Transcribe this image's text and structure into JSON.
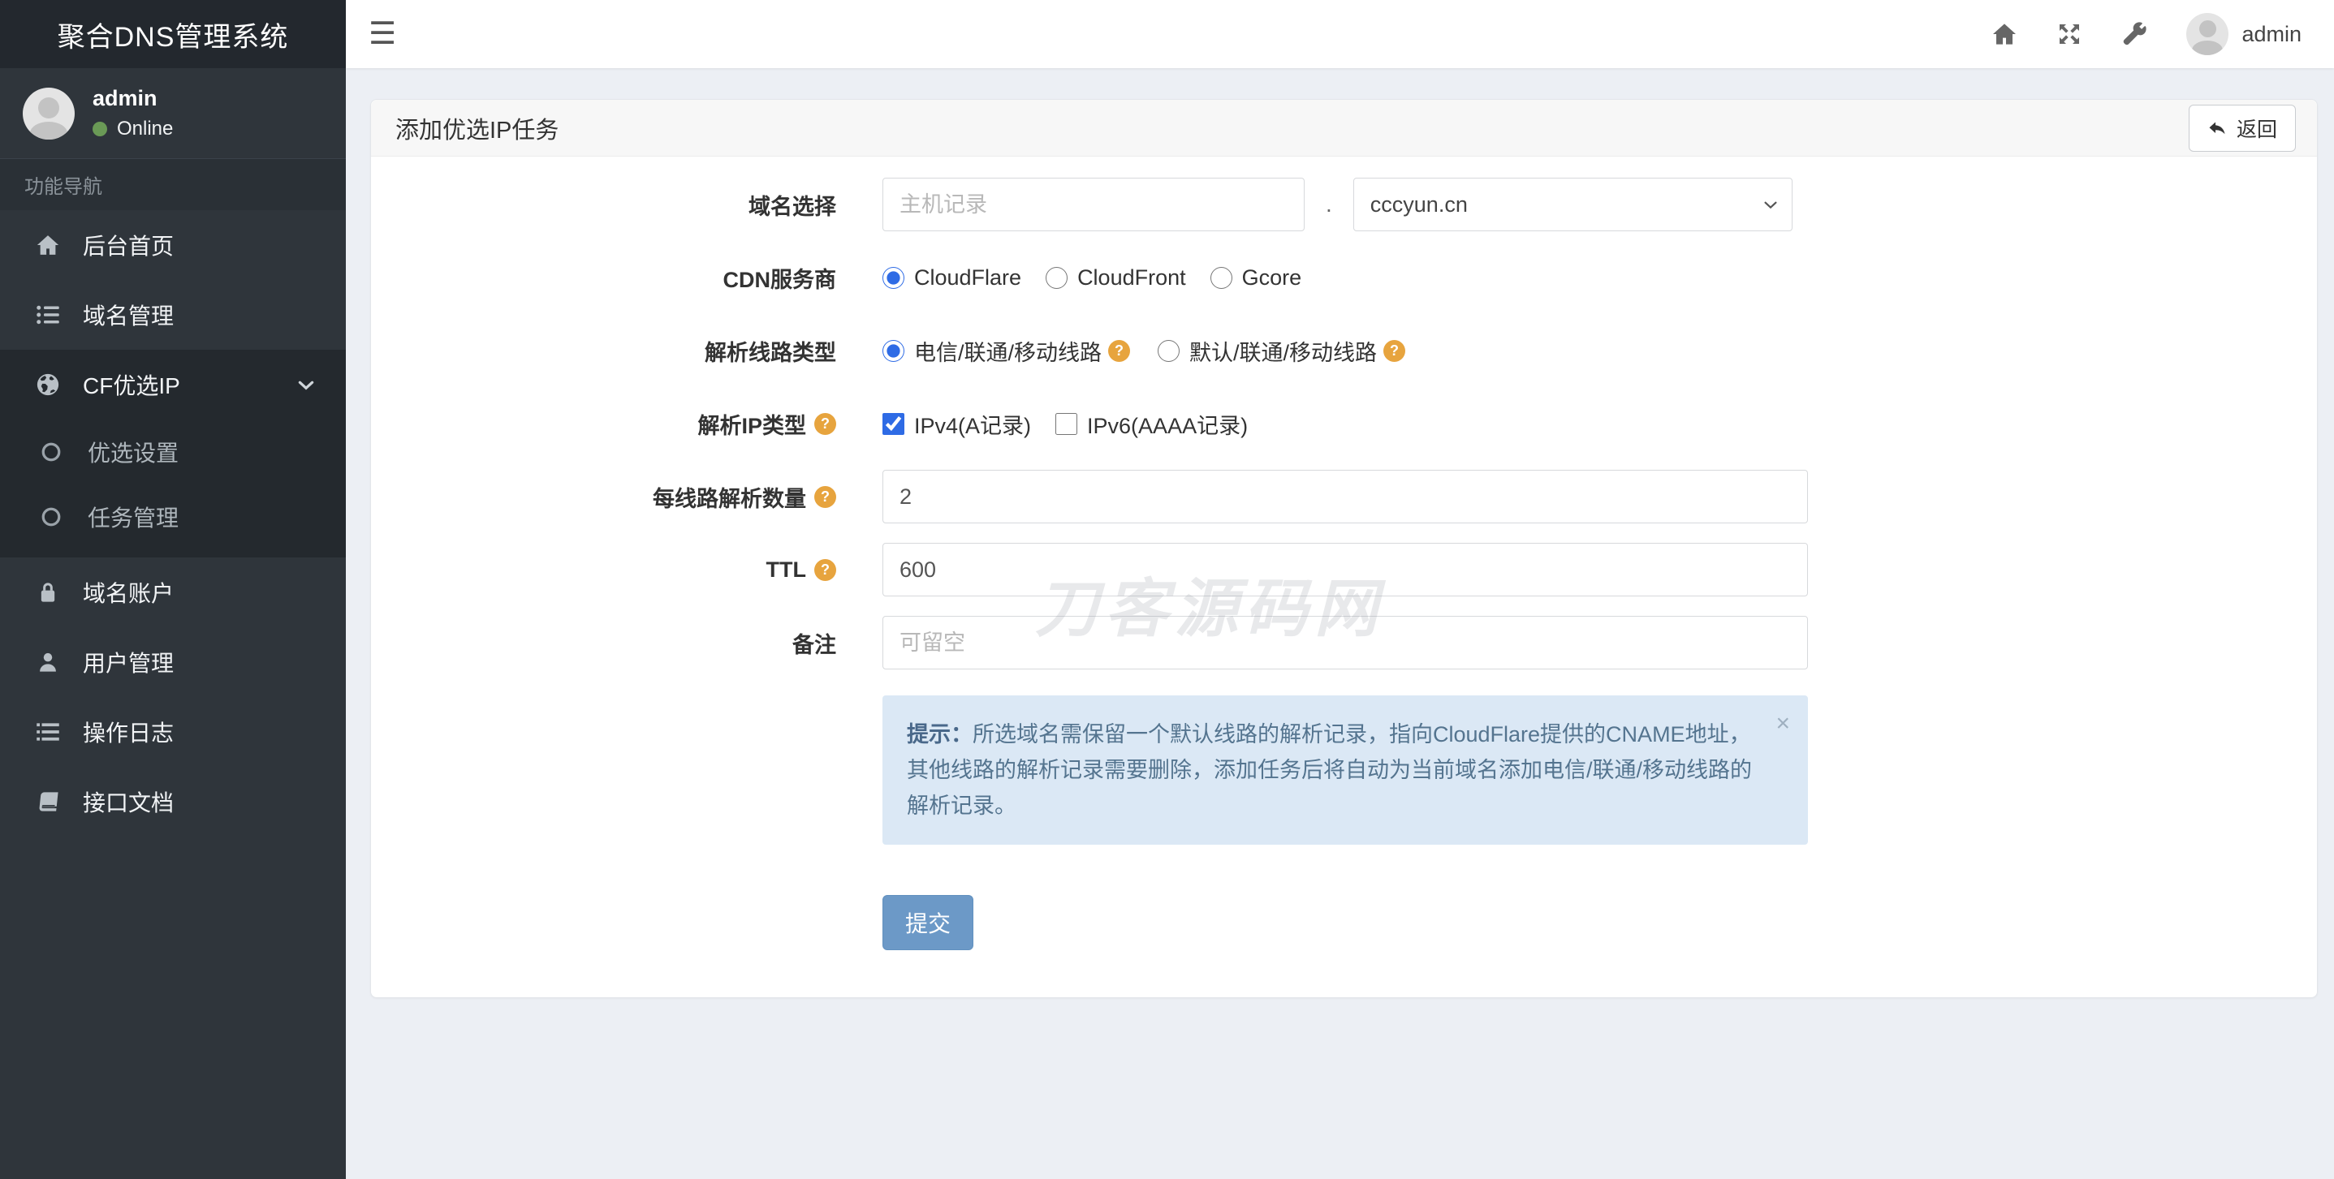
{
  "app": {
    "title": "聚合DNS管理系统"
  },
  "user": {
    "name": "admin",
    "status": "Online"
  },
  "topbar": {
    "username": "admin"
  },
  "sidebar": {
    "section_label": "功能导航",
    "items": [
      {
        "label": "后台首页",
        "icon": "home-icon"
      },
      {
        "label": "域名管理",
        "icon": "list-icon"
      },
      {
        "label": "CF优选IP",
        "icon": "globe-icon",
        "expanded": true,
        "children": [
          {
            "label": "优选设置"
          },
          {
            "label": "任务管理"
          }
        ]
      },
      {
        "label": "域名账户",
        "icon": "lock-icon"
      },
      {
        "label": "用户管理",
        "icon": "user-icon"
      },
      {
        "label": "操作日志",
        "icon": "log-icon"
      },
      {
        "label": "接口文档",
        "icon": "book-icon"
      }
    ]
  },
  "panel": {
    "title": "添加优选IP任务",
    "back_label": "返回"
  },
  "form": {
    "domain": {
      "label": "域名选择",
      "host_placeholder": "主机记录",
      "separator": ".",
      "selected": "cccyun.cn"
    },
    "cdn": {
      "label": "CDN服务商",
      "options": [
        "CloudFlare",
        "CloudFront",
        "Gcore"
      ],
      "selected": "CloudFlare"
    },
    "line_type": {
      "label": "解析线路类型",
      "options": [
        "电信/联通/移动线路",
        "默认/联通/移动线路"
      ],
      "selected": "电信/联通/移动线路",
      "help": "?"
    },
    "ip_type": {
      "label": "解析IP类型",
      "help": "?",
      "options": [
        "IPv4(A记录)",
        "IPv6(AAAA记录)"
      ],
      "checked": [
        "IPv4(A记录)"
      ]
    },
    "per_line": {
      "label": "每线路解析数量",
      "help": "?",
      "value": "2"
    },
    "ttl": {
      "label": "TTL",
      "help": "?",
      "value": "600"
    },
    "remark": {
      "label": "备注",
      "placeholder": "可留空"
    },
    "submit_label": "提交"
  },
  "alert": {
    "prefix": "提示：",
    "text": "所选域名需保留一个默认线路的解析记录，指向CloudFlare提供的CNAME地址，其他线路的解析记录需要删除，添加任务后将自动为当前域名添加电信/联通/移动线路的解析记录。",
    "close": "×"
  },
  "watermark": "刀客源码网",
  "colors": {
    "sidebar_bg": "#2f353b",
    "sidebar_active_bg": "#24292e",
    "brand_bg": "#23282e",
    "page_bg": "#eceff4",
    "panel_header_bg": "#f7f7f7",
    "accent_blue": "#2e6be5",
    "submit_bg": "#6c99c7",
    "alert_bg": "#dbe8f5",
    "alert_text": "#54748f",
    "help_icon_bg": "#e7a43e",
    "online_dot": "#6a9a56"
  }
}
